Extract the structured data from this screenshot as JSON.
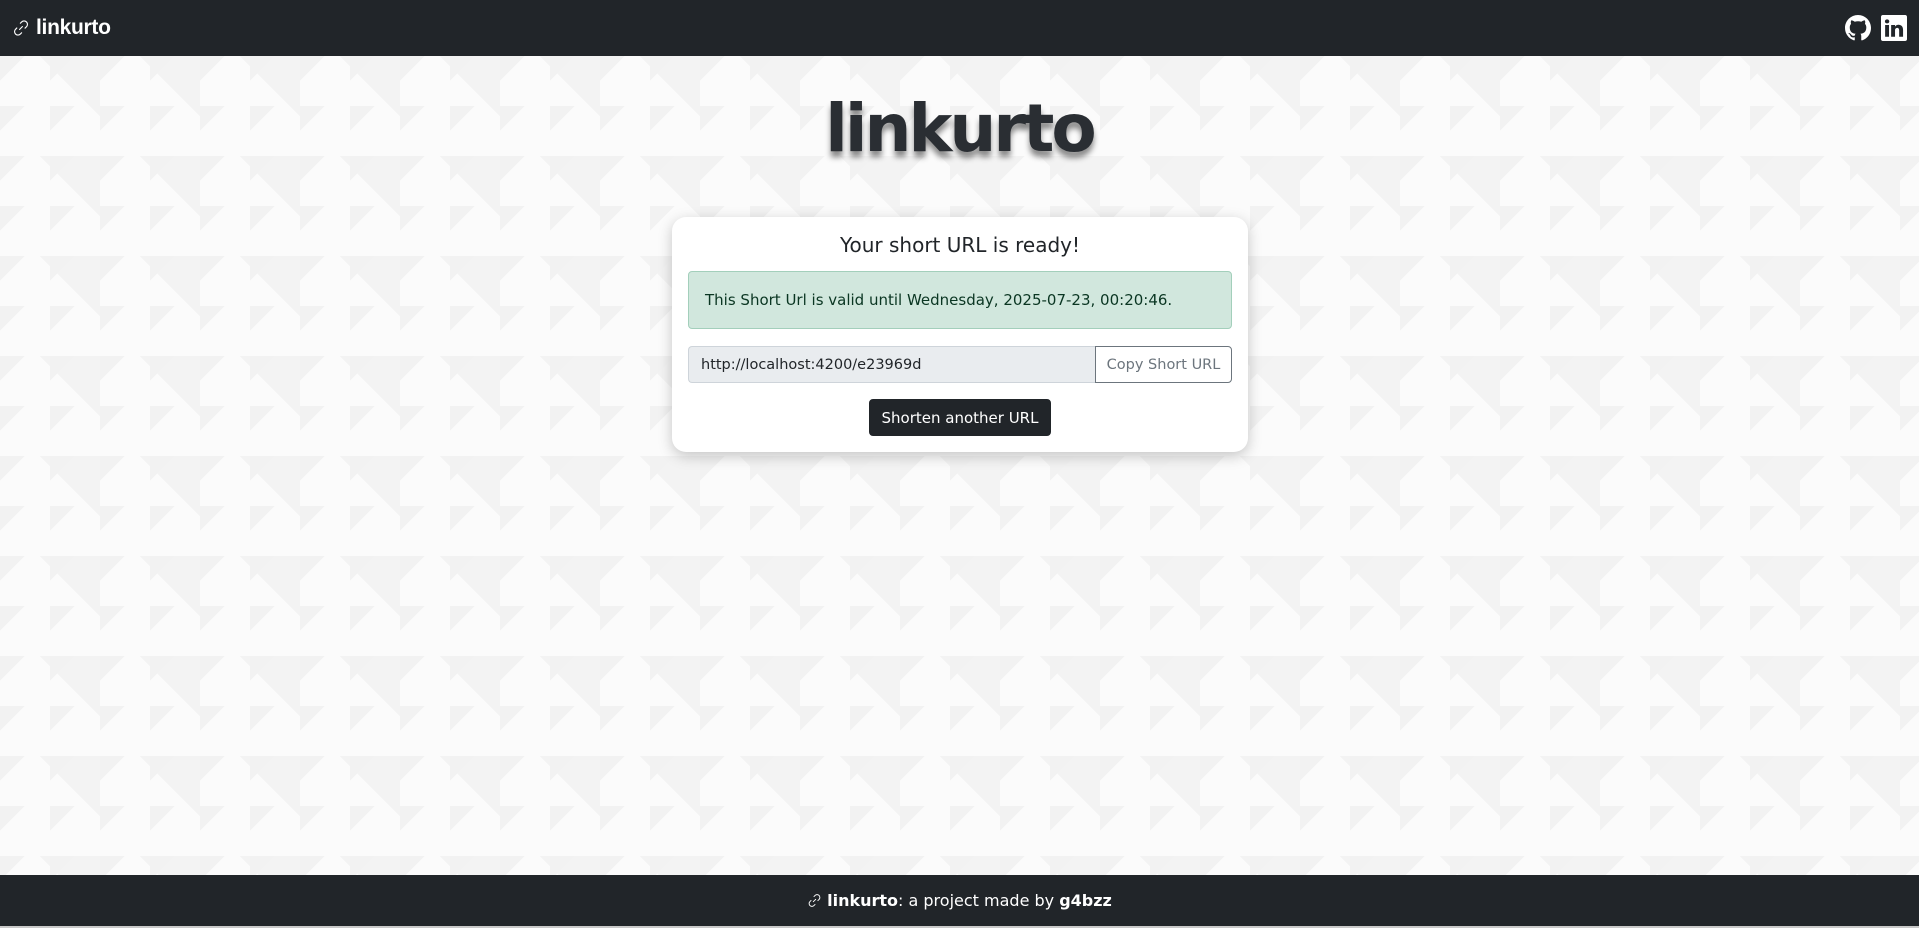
{
  "navbar": {
    "brand": "linkurto",
    "brand_icon": "link-icon",
    "github_icon": "github-icon",
    "linkedin_icon": "linkedin-icon"
  },
  "hero": {
    "title": "linkurto"
  },
  "card": {
    "title": "Your short URL is ready!",
    "alert_text": "This Short Url is valid until Wednesday, 2025-07-23, 00:20:46.",
    "short_url": "http://localhost:4200/e23969d",
    "copy_label": "Copy Short URL",
    "another_label": "Shorten another URL"
  },
  "footer": {
    "brand": "linkurto",
    "middle": ": a project made by ",
    "author": "g4bzz"
  },
  "colors": {
    "dark": "#212529",
    "alert_bg": "#d1e7dd",
    "alert_border": "#a3cfbb",
    "alert_text": "#0a3622",
    "input_bg": "#e9ecef",
    "secondary": "#6c757d"
  }
}
